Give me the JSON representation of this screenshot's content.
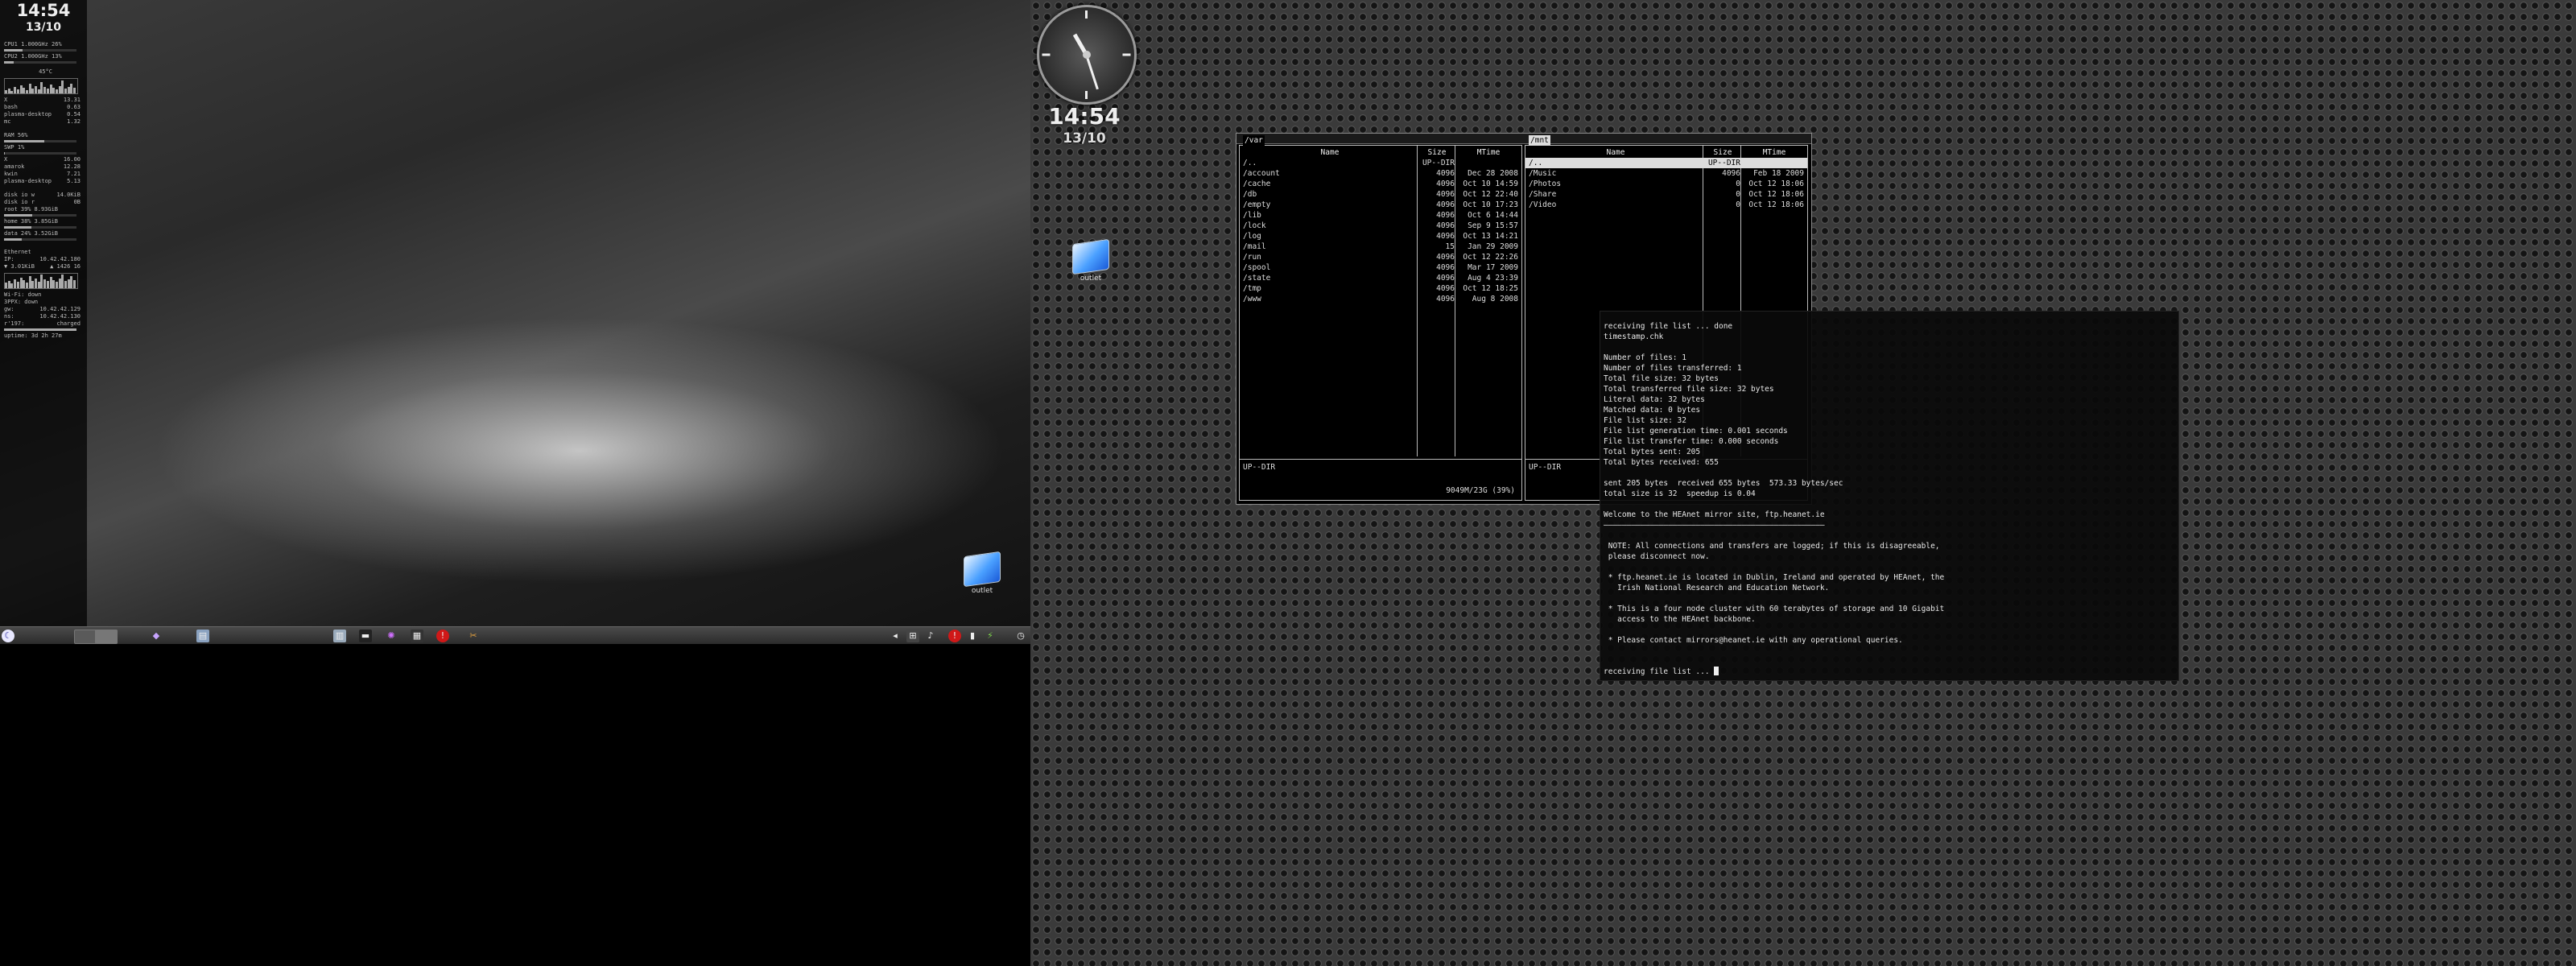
{
  "left": {
    "conky": {
      "time": "14:54",
      "date": "13/10",
      "cpu1": {
        "label": "CPU1",
        "freq": "1.000GHz",
        "pct": "26%",
        "level": 0.26
      },
      "cpu2": {
        "label": "CPU2",
        "freq": "1.000GHz",
        "pct": "13%",
        "level": 0.13
      },
      "temp": "45°C",
      "procs": [
        {
          "name": "X",
          "val": "13.31"
        },
        {
          "name": "bash",
          "val": "0.63"
        },
        {
          "name": "plasma-desktop",
          "val": "0.54"
        },
        {
          "name": "mc",
          "val": "1.32"
        }
      ],
      "ram": {
        "label": "RAM",
        "pct": "56%",
        "level": 0.56
      },
      "swap": {
        "label": "SWP",
        "pct": "1%",
        "level": 0.01
      },
      "memprocs": [
        {
          "name": "X",
          "val": "16.00"
        },
        {
          "name": "amarok",
          "val": "12.28"
        },
        {
          "name": "kwin",
          "val": "7.21"
        },
        {
          "name": "plasma-desktop",
          "val": "5.13"
        }
      ],
      "disk_io": [
        {
          "name": "disk io w",
          "val": "14.0KiB"
        },
        {
          "name": "disk io r",
          "val": "0B"
        }
      ],
      "fs": [
        {
          "name": "root",
          "pct": "39%",
          "size": "8.93GiB",
          "level": 0.39
        },
        {
          "name": "home",
          "pct": "38%",
          "size": "3.85GiB",
          "level": 0.38
        },
        {
          "name": "data",
          "pct": "24%",
          "size": "3.52GiB",
          "level": 0.24
        }
      ],
      "net": [
        {
          "name": "Ethernet",
          "val": ""
        },
        {
          "name": "IP:",
          "val": "10.42.42.180"
        },
        {
          "name": "▼ 3.01KiB",
          "val": "▲ 1426 16"
        }
      ],
      "net2": [
        {
          "name": "Wi-Fi: down",
          "val": ""
        },
        {
          "name": "3PPX: down",
          "val": ""
        },
        {
          "name": "gw:",
          "val": "10.42.42.129"
        },
        {
          "name": "ns:",
          "val": "10.42.42.130"
        },
        {
          "name": "r'197:",
          "val": "charged"
        }
      ],
      "uptime": {
        "name": "uptime:",
        "val": "3d 2h 27m"
      }
    },
    "desktop_icon": {
      "label": "outlet"
    },
    "taskbar": {
      "icons": [
        "kde-menu-icon",
        "app-icon",
        "browser-icon",
        "chat-icon",
        "terminal-icon",
        "tray-icon"
      ]
    }
  },
  "right": {
    "clock": {
      "time": "14:54",
      "date": "13/10"
    },
    "desktop_icon": {
      "label": "outlet"
    },
    "mc": {
      "left_panel": {
        "path": "/var",
        "headers": {
          "name": "Name",
          "size": "Size",
          "mtime": "MTime"
        },
        "rows": [
          {
            "name": "/..",
            "size": "UP--DIR",
            "mtime": ""
          },
          {
            "name": "/account",
            "size": "4096",
            "mtime": "Dec 28  2008"
          },
          {
            "name": "/cache",
            "size": "4096",
            "mtime": "Oct 10 14:59"
          },
          {
            "name": "/db",
            "size": "4096",
            "mtime": "Oct 12 22:40"
          },
          {
            "name": "/empty",
            "size": "4096",
            "mtime": "Oct 10 17:23"
          },
          {
            "name": "/lib",
            "size": "4096",
            "mtime": "Oct  6 14:44"
          },
          {
            "name": "/lock",
            "size": "4096",
            "mtime": "Sep  9 15:57"
          },
          {
            "name": "/log",
            "size": "4096",
            "mtime": "Oct 13 14:21"
          },
          {
            "name": "/mail",
            "size": "15",
            "mtime": "Jan 29  2009"
          },
          {
            "name": "/run",
            "size": "4096",
            "mtime": "Oct 12 22:26"
          },
          {
            "name": "/spool",
            "size": "4096",
            "mtime": "Mar 17  2009"
          },
          {
            "name": "/state",
            "size": "4096",
            "mtime": "Aug  4 23:39"
          },
          {
            "name": "/tmp",
            "size": "4096",
            "mtime": "Oct 12 18:25"
          },
          {
            "name": "/www",
            "size": "4096",
            "mtime": "Aug  8  2008"
          }
        ],
        "footer": "UP--DIR",
        "free": "9049M/23G (39%)"
      },
      "right_panel": {
        "path": "/mnt",
        "headers": {
          "name": "Name",
          "size": "Size",
          "mtime": "MTime"
        },
        "rows": [
          {
            "name": "/..",
            "size": "UP--DIR",
            "mtime": ""
          },
          {
            "name": "/Music",
            "size": "4096",
            "mtime": "Feb 18  2009"
          },
          {
            "name": "/Photos",
            "size": "0",
            "mtime": "Oct 12 18:06"
          },
          {
            "name": "/Share",
            "size": "0",
            "mtime": "Oct 12 18:06"
          },
          {
            "name": "/Video",
            "size": "0",
            "mtime": "Oct 12 18:06"
          }
        ],
        "footer": "UP--DIR"
      }
    },
    "terminal": {
      "lines": [
        "receiving file list ... done",
        "timestamp.chk",
        "",
        "Number of files: 1",
        "Number of files transferred: 1",
        "Total file size: 32 bytes",
        "Total transferred file size: 32 bytes",
        "Literal data: 32 bytes",
        "Matched data: 0 bytes",
        "File list size: 32",
        "File list generation time: 0.001 seconds",
        "File list transfer time: 0.000 seconds",
        "Total bytes sent: 205",
        "Total bytes received: 655",
        "",
        "sent 205 bytes  received 655 bytes  573.33 bytes/sec",
        "total size is 32  speedup is 0.04",
        "",
        "Welcome to the HEAnet mirror site, ftp.heanet.ie",
        "————————————————————————————————————————————————",
        "",
        " NOTE: All connections and transfers are logged; if this is disagreeable,",
        " please disconnect now.",
        "",
        " * ftp.heanet.ie is located in Dublin, Ireland and operated by HEAnet, the",
        "   Irish National Research and Education Network.",
        "",
        " * This is a four node cluster with 60 terabytes of storage and 10 Gigabit",
        "   access to the HEAnet backbone.",
        "",
        " * Please contact mirrors@heanet.ie with any operational queries.",
        "",
        "",
        "receiving file list ... "
      ]
    }
  }
}
